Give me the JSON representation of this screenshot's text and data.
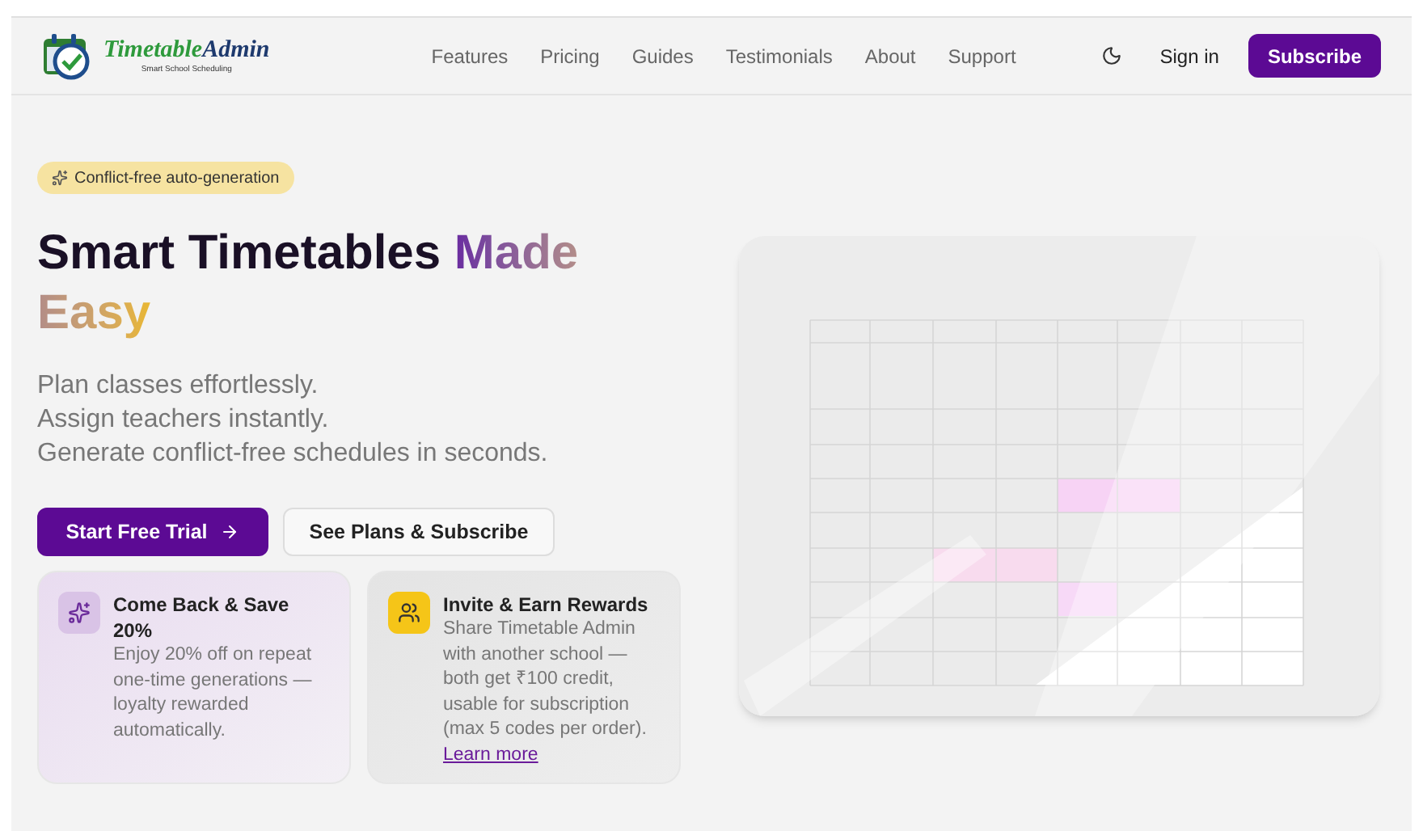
{
  "logo": {
    "name_first": "Timetable",
    "name_second": "Admin",
    "tagline": "Smart School Scheduling"
  },
  "nav": {
    "links": [
      "Features",
      "Pricing",
      "Guides",
      "Testimonials",
      "About",
      "Support"
    ],
    "sign_in": "Sign in",
    "subscribe": "Subscribe"
  },
  "hero": {
    "badge": "Conflict-free auto-generation",
    "title_plain": "Smart Timetables",
    "title_highlight": "Made Easy",
    "lines": [
      "Plan classes effortlessly.",
      "Assign teachers instantly.",
      "Generate conflict-free schedules in seconds."
    ],
    "primary_button": "Start Free Trial",
    "secondary_button": "See Plans & Subscribe",
    "cards": [
      {
        "kind": "sparkle",
        "title": "Come Back & Save 20%",
        "text": "Enjoy 20% off on repeat one-time generations — loyalty rewarded automatically."
      },
      {
        "kind": "people",
        "title": "Invite & Earn Rewards",
        "text": "Share Timetable Admin with another school — both get ₹100 credit, usable for subscription (max 5 codes per order).",
        "link": "Learn more"
      }
    ]
  }
}
